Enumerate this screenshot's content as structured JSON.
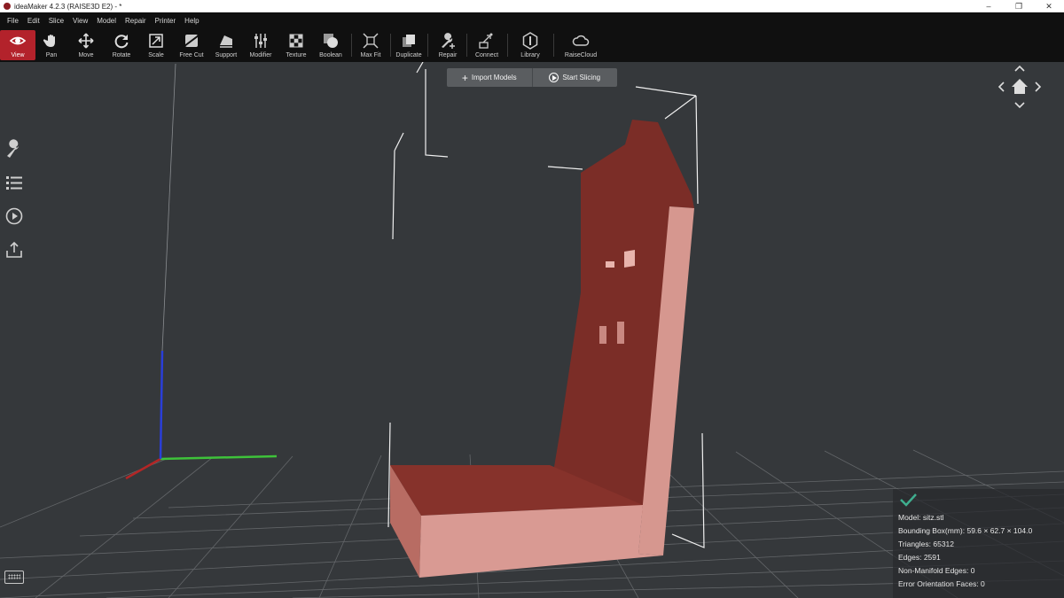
{
  "window": {
    "title": "ideaMaker 4.2.3 (RAISE3D E2) - *",
    "controls": [
      "–",
      "❐",
      "✕"
    ]
  },
  "menu": [
    "File",
    "Edit",
    "Slice",
    "View",
    "Model",
    "Repair",
    "Printer",
    "Help"
  ],
  "toolbar": [
    {
      "label": "View",
      "icon": "eye-icon",
      "active": true
    },
    {
      "label": "Pan",
      "icon": "hand-icon"
    },
    {
      "label": "Move",
      "icon": "move-arrows-icon"
    },
    {
      "label": "Rotate",
      "icon": "rotate-icon"
    },
    {
      "label": "Scale",
      "icon": "scale-icon"
    },
    {
      "label": "Free Cut",
      "icon": "cut-icon"
    },
    {
      "label": "Support",
      "icon": "support-icon"
    },
    {
      "label": "Modifier",
      "icon": "sliders-icon"
    },
    {
      "label": "Texture",
      "icon": "checker-icon"
    },
    {
      "label": "Boolean",
      "icon": "boolean-icon"
    },
    {
      "label": "Max Fit",
      "icon": "maxfit-icon"
    },
    {
      "label": "Duplicate",
      "icon": "duplicate-icon"
    },
    {
      "label": "Repair",
      "icon": "wrench-plus-icon"
    },
    {
      "label": "Connect",
      "icon": "connect-icon"
    },
    {
      "label": "Library",
      "icon": "library-icon"
    },
    {
      "label": "RaiseCloud",
      "icon": "cloud-icon"
    }
  ],
  "actions": {
    "import": "Import Models",
    "slice": "Start Slicing"
  },
  "sidebar": [
    "wrench-icon",
    "list-icon",
    "play-circle-icon",
    "export-icon"
  ],
  "model_info": {
    "model": "Model: sitz.stl",
    "bbox": "Bounding Box(mm): 59.6 × 62.7 × 104.0",
    "triangles": "Triangles: 65312",
    "edges": "Edges: 2591",
    "non_manifold": "Non-Manifold Edges: 0",
    "error_faces": "Error Orientation Faces: 0"
  },
  "colors": {
    "accent": "#b3222b",
    "model_front": "#d99a93",
    "model_back": "#7a2f27",
    "check": "#3fae8f"
  }
}
